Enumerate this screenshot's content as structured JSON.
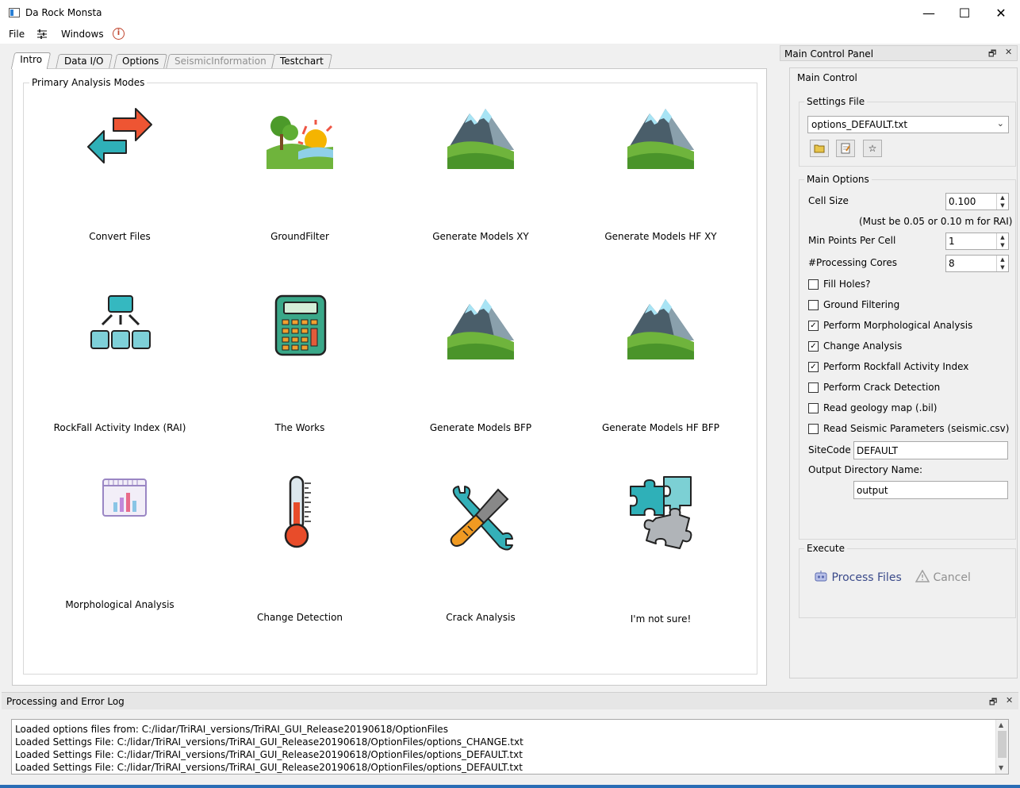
{
  "window": {
    "title": "Da Rock Monsta",
    "minimize": "—",
    "maximize": "☐",
    "close": "✕"
  },
  "menu": {
    "file": "File",
    "windows": "Windows"
  },
  "tabs": [
    "Intro",
    "Data I/O",
    "Options",
    "SeismicInformation",
    "Testchart"
  ],
  "intro": {
    "group_title": "Primary Analysis Modes",
    "tiles": [
      {
        "label": "Convert Files",
        "icon": "convert-arrows-icon"
      },
      {
        "label": "GroundFilter",
        "icon": "landscape-sun-icon"
      },
      {
        "label": "Generate Models XY",
        "icon": "mountain-icon"
      },
      {
        "label": "Generate Models HF XY",
        "icon": "mountain-icon"
      },
      {
        "label": "RockFall Activity Index (RAI)",
        "icon": "hierarchy-icon"
      },
      {
        "label": "The Works",
        "icon": "calculator-icon"
      },
      {
        "label": "Generate Models BFP",
        "icon": "mountain-icon"
      },
      {
        "label": "Generate Models HF BFP",
        "icon": "mountain-icon"
      },
      {
        "label": "Morphological Analysis",
        "icon": "chart-icon"
      },
      {
        "label": "Change Detection",
        "icon": "thermometer-icon"
      },
      {
        "label": "Crack Analysis",
        "icon": "tools-icon"
      },
      {
        "label": "I'm not sure!",
        "icon": "puzzle-icon"
      }
    ]
  },
  "panel": {
    "title": "Main Control Panel",
    "main_control": "Main Control",
    "settings_file_title": "Settings File",
    "settings_file_value": "options_DEFAULT.txt",
    "main_options_title": "Main Options",
    "cell_size_label": "Cell Size",
    "cell_size_value": "0.100",
    "cell_size_note": "(Must be 0.05 or 0.10 m for RAI)",
    "min_points_label": "Min Points Per Cell",
    "min_points_value": "1",
    "cores_label": "#Processing Cores",
    "cores_value": "8",
    "checks": [
      {
        "label": "Fill Holes?",
        "checked": false
      },
      {
        "label": "Ground Filtering",
        "checked": false
      },
      {
        "label": "Perform Morphological Analysis",
        "checked": true
      },
      {
        "label": "Change Analysis",
        "checked": true
      },
      {
        "label": "Perform Rockfall Activity Index",
        "checked": true
      },
      {
        "label": "Perform Crack Detection",
        "checked": false
      },
      {
        "label": "Read geology map (.bil)",
        "checked": false
      },
      {
        "label": "Read Seismic Parameters (seismic.csv)",
        "checked": false
      }
    ],
    "sitecode_label": "SiteCode",
    "sitecode_value": "DEFAULT",
    "output_dir_label": "Output Directory Name:",
    "output_dir_value": "output",
    "execute_title": "Execute",
    "process_label": "Process Files",
    "cancel_label": "Cancel"
  },
  "log": {
    "title": "Processing and Error Log",
    "lines": [
      "Loaded options files from: C:/lidar/TriRAI_versions/TriRAI_GUI_Release20190618/OptionFiles",
      "Loaded Settings File:  C:/lidar/TriRAI_versions/TriRAI_GUI_Release20190618/OptionFiles/options_CHANGE.txt",
      "Loaded Settings File:  C:/lidar/TriRAI_versions/TriRAI_GUI_Release20190618/OptionFiles/options_DEFAULT.txt",
      "Loaded Settings File:  C:/lidar/TriRAI_versions/TriRAI_GUI_Release20190618/OptionFiles/options_DEFAULT.txt"
    ]
  }
}
